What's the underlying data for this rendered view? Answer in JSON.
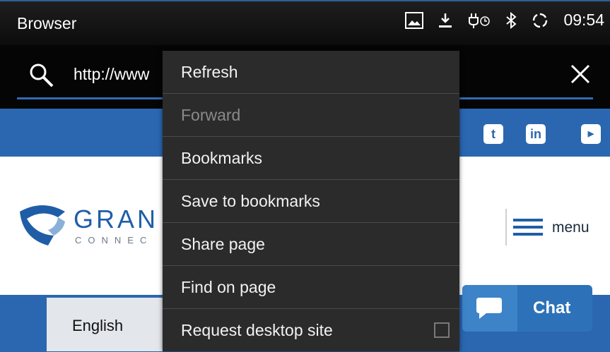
{
  "statusbar": {
    "title": "Browser",
    "time": "09:54",
    "icons": [
      "image-icon",
      "download-icon",
      "charging-icon",
      "bluetooth-icon",
      "sync-icon"
    ]
  },
  "urlbar": {
    "url": "http://www"
  },
  "site": {
    "social_icons": [
      "twitter-icon",
      "linkedin-icon",
      "youtube-icon"
    ],
    "logo_text": "GRAN",
    "logo_sub": "CONNEC",
    "menu_label": "menu",
    "language": "English",
    "chat_label": "Chat"
  },
  "popup": {
    "items": [
      {
        "label": "Refresh",
        "enabled": true
      },
      {
        "label": "Forward",
        "enabled": false
      },
      {
        "label": "Bookmarks",
        "enabled": true
      },
      {
        "label": "Save to bookmarks",
        "enabled": true
      },
      {
        "label": "Share page",
        "enabled": true
      },
      {
        "label": "Find on page",
        "enabled": true
      },
      {
        "label": "Request desktop site",
        "enabled": true,
        "checked": false
      }
    ]
  },
  "colors": {
    "accent": "#2f6db5",
    "site_blue": "#2a67b0",
    "popup_bg": "#2b2b2b"
  }
}
